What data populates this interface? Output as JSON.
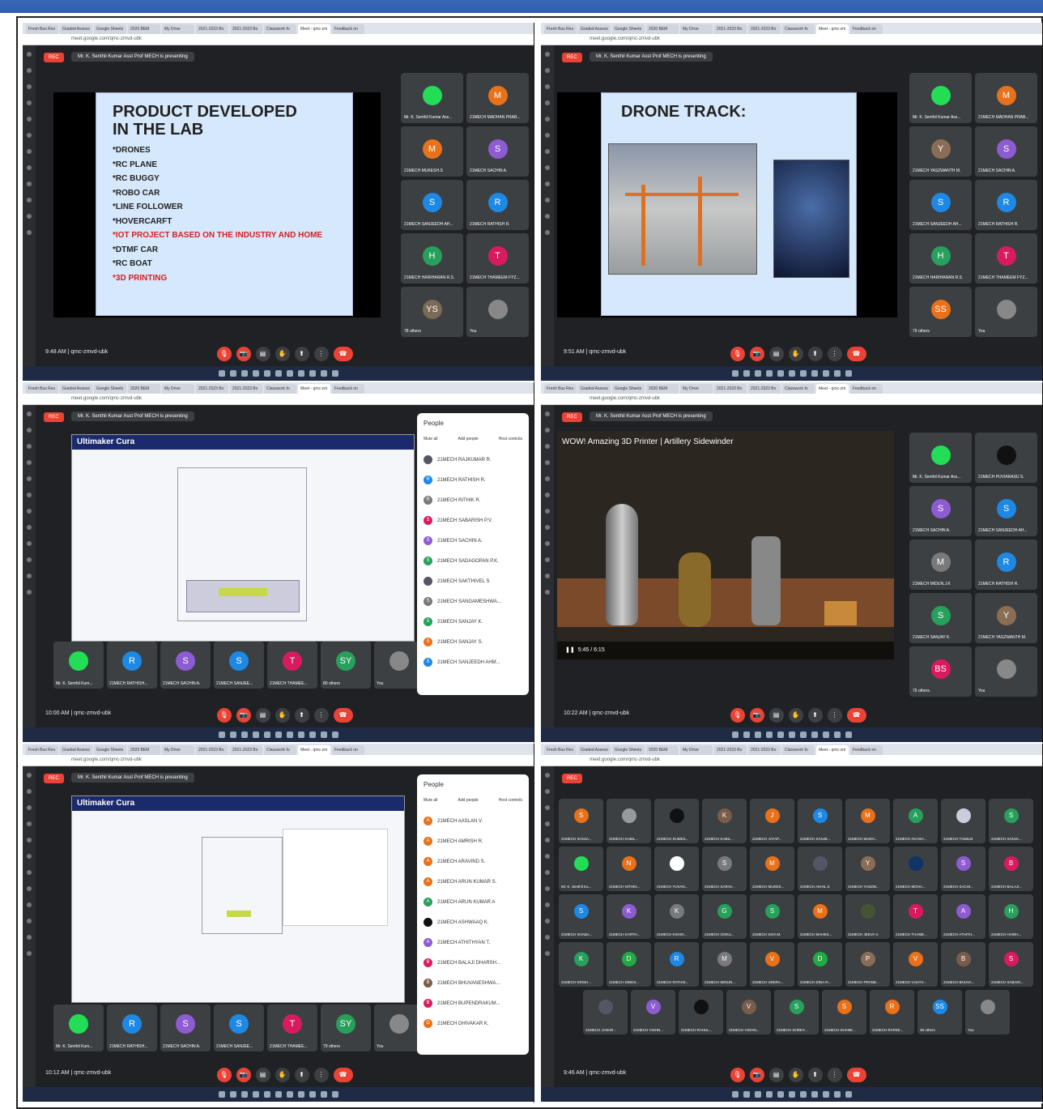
{
  "browser": {
    "tabs": [
      "Fresh Bus Res",
      "Graded Assess",
      "Google Sheets",
      "2020 BEM",
      "My Drive",
      "2021-2023 Bo",
      "2021-2023 Bo",
      "Classwork fo",
      "Meet - qmc-zm",
      "Feedback on"
    ],
    "url": "meet.google.com/qmc-zmvd-ubk"
  },
  "meet": {
    "rec": "REC",
    "presenting": "Mr. K. Senthil Kumar Asst Prof MECH is presenting",
    "code": "qmc-zmvd-ubk"
  },
  "s1": {
    "time": "9:48 AM",
    "slide_title": "PRODUCT DEVELOPED IN THE LAB",
    "items": [
      "DRONES",
      "RC PLANE",
      "RC BUGGY",
      "ROBO CAR",
      "LINE FOLLOWER",
      "HOVERCARFT",
      "IOT PROJECT BASED ON THE INDUSTRY AND HOME",
      "DTMF CAR",
      "RC BOAT",
      "3D PRINTING"
    ],
    "tiles": [
      {
        "n": "Mr. K. Senthil Kumar Ass...",
        "l": "",
        "c": "#2d5"
      },
      {
        "n": "21MECH MADHAN PRAB...",
        "l": "M",
        "c": "#e8711a"
      },
      {
        "n": "21MECH MUKESH.S",
        "l": "M",
        "c": "#e8711a"
      },
      {
        "n": "21MECH SACHIN A.",
        "l": "S",
        "c": "#8e5cd1"
      },
      {
        "n": "21MECH SANJEEDH AH...",
        "l": "S",
        "c": "#1e88e5"
      },
      {
        "n": "21MECH RATHISH R.",
        "l": "R",
        "c": "#1e88e5"
      },
      {
        "n": "21MECH HARIHARAN R.S.",
        "l": "H",
        "c": "#27a05b"
      },
      {
        "n": "21MECH THAMEEM FYZ...",
        "l": "T",
        "c": "#d81b60"
      },
      {
        "n": "78 others",
        "l": "YS",
        "c": "#7a6b55"
      },
      {
        "n": "You",
        "l": "",
        "c": "#888"
      }
    ]
  },
  "s2": {
    "time": "9:51 AM",
    "slide_title": "DRONE TRACK:",
    "tiles": [
      {
        "n": "Mr. K. Senthil Kumar Ass...",
        "l": "",
        "c": "#2d5"
      },
      {
        "n": "21MECH MADHAN PRAB...",
        "l": "M",
        "c": "#e8711a"
      },
      {
        "n": "21MECH YASZWANTH M.",
        "l": "Y",
        "c": "#8a6d55"
      },
      {
        "n": "21MECH SACHIN A.",
        "l": "S",
        "c": "#8e5cd1"
      },
      {
        "n": "21MECH SANJEEDH AH...",
        "l": "S",
        "c": "#1e88e5"
      },
      {
        "n": "21MECH RATHISH R.",
        "l": "R",
        "c": "#1e88e5"
      },
      {
        "n": "21MECH HARIHARAN R.S.",
        "l": "H",
        "c": "#27a05b"
      },
      {
        "n": "21MECH THAMEEM FYZ...",
        "l": "T",
        "c": "#d81b60"
      },
      {
        "n": "79 others",
        "l": "SS",
        "c": "#e8711a"
      },
      {
        "n": "You",
        "l": "",
        "c": "#888"
      }
    ]
  },
  "s3": {
    "time": "10:00 AM",
    "app": "Ultimaker Cura",
    "people_title": "People",
    "mute": "Mute all",
    "add": "Add people",
    "host": "Host controls",
    "people": [
      {
        "n": "21MECH RAJKUMAR R.",
        "l": "",
        "c": "#556"
      },
      {
        "n": "21MECH RATHISH R.",
        "l": "R",
        "c": "#1e88e5"
      },
      {
        "n": "21MECH RITHIK R.",
        "l": "R",
        "c": "#7a7a7a"
      },
      {
        "n": "21MECH SABARISH P.V.",
        "l": "S",
        "c": "#d81b60"
      },
      {
        "n": "21MECH SACHIN A.",
        "l": "S",
        "c": "#8e5cd1"
      },
      {
        "n": "21MECH SADAGOPAN P.K.",
        "l": "S",
        "c": "#27a05b"
      },
      {
        "n": "21MECH SAKTHIVEL S",
        "l": "",
        "c": "#556"
      },
      {
        "n": "21MECH SANGAMESHWA...",
        "l": "S",
        "c": "#7a7a7a"
      },
      {
        "n": "21MECH SANJAY K.",
        "l": "S",
        "c": "#27a05b"
      },
      {
        "n": "21MECH SANJAY S.",
        "l": "S",
        "c": "#e8711a"
      },
      {
        "n": "21MECH SANJEEDH AHM...",
        "l": "S",
        "c": "#1e88e5"
      }
    ],
    "strip": [
      {
        "n": "Mr. K. Senthil Kum...",
        "l": "",
        "c": "#2d5"
      },
      {
        "n": "21MECH RATHISH...",
        "l": "R",
        "c": "#1e88e5"
      },
      {
        "n": "21MECH SACHIN A.",
        "l": "S",
        "c": "#8e5cd1"
      },
      {
        "n": "21MECH SANJEE...",
        "l": "S",
        "c": "#1e88e5"
      },
      {
        "n": "21MECH THAMEE...",
        "l": "T",
        "c": "#d81b60"
      },
      {
        "n": "80 others",
        "l": "SY",
        "c": "#27a05b"
      },
      {
        "n": "You",
        "l": "",
        "c": "#888"
      }
    ]
  },
  "s4": {
    "time": "10:22 AM",
    "video_title": "WOW! Amazing 3D Printer | Artillery Sidewinder",
    "video_time": "5:45 / 6:15",
    "tiles": [
      {
        "n": "Mr. K. Senthil Kumar Ass...",
        "l": "",
        "c": "#2d5"
      },
      {
        "n": "21MECH PUVIARASU S.",
        "l": "",
        "c": "#111"
      },
      {
        "n": "21MECH SACHIN A.",
        "l": "S",
        "c": "#8e5cd1"
      },
      {
        "n": "21MECH SANJEEDH AH...",
        "l": "S",
        "c": "#1e88e5"
      },
      {
        "n": "21MECH MIDUN.J.K",
        "l": "M",
        "c": "#7a7a7a"
      },
      {
        "n": "21MECH RATHISH R.",
        "l": "R",
        "c": "#1e88e5"
      },
      {
        "n": "21MECH SANJAY K.",
        "l": "S",
        "c": "#27a05b"
      },
      {
        "n": "21MECH YASZWANTH M.",
        "l": "Y",
        "c": "#8a6d55"
      },
      {
        "n": "76 others",
        "l": "BS",
        "c": "#d81b60"
      },
      {
        "n": "You",
        "l": "",
        "c": "#888"
      }
    ]
  },
  "s5": {
    "time": "10:12 AM",
    "app": "Ultimaker Cura",
    "people_title": "People",
    "mute": "Mute all",
    "add": "Add people",
    "host": "Host controls",
    "people": [
      {
        "n": "21MECH AASLAN V.",
        "l": "A",
        "c": "#e8711a"
      },
      {
        "n": "21MECH AMRISH R.",
        "l": "A",
        "c": "#e8711a"
      },
      {
        "n": "21MECH ARAVIND S.",
        "l": "A",
        "c": "#e8711a"
      },
      {
        "n": "21MECH ARUN KUMAR S.",
        "l": "A",
        "c": "#e8711a"
      },
      {
        "n": "21MECH ARUN KUMAR A",
        "l": "A",
        "c": "#27a05b"
      },
      {
        "n": "21MECH ASHWAAQ K.",
        "l": "",
        "c": "#111"
      },
      {
        "n": "21MECH ATHITHYAN T.",
        "l": "A",
        "c": "#8e5cd1"
      },
      {
        "n": "21MECH BALAJI DHARSH...",
        "l": "B",
        "c": "#d81b60"
      },
      {
        "n": "21MECH BHUVANESHWA...",
        "l": "B",
        "c": "#7a5c4a"
      },
      {
        "n": "21MECH BUPENDRAKUM...",
        "l": "B",
        "c": "#d81b60"
      },
      {
        "n": "21MECH DHIVAKAR K.",
        "l": "D",
        "c": "#e8711a"
      }
    ],
    "strip": [
      {
        "n": "Mr. K. Senthil Kum...",
        "l": "",
        "c": "#2d5"
      },
      {
        "n": "21MECH RATHISH...",
        "l": "R",
        "c": "#1e88e5"
      },
      {
        "n": "21MECH SACHIN A.",
        "l": "S",
        "c": "#8e5cd1"
      },
      {
        "n": "21MECH SANJEE...",
        "l": "S",
        "c": "#1e88e5"
      },
      {
        "n": "21MECH THAMEE...",
        "l": "T",
        "c": "#d81b60"
      },
      {
        "n": "79 others",
        "l": "SY",
        "c": "#27a05b"
      },
      {
        "n": "You",
        "l": "",
        "c": "#888"
      }
    ]
  },
  "s6": {
    "time": "9:46 AM",
    "grid": [
      {
        "n": "21MECH SANJA...",
        "l": "S",
        "c": "#e8711a"
      },
      {
        "n": "21MECH KABIL...",
        "l": "",
        "c": "#999"
      },
      {
        "n": "21MECH SUMES...",
        "l": "",
        "c": "#111"
      },
      {
        "n": "21MECH KABIL...",
        "l": "K",
        "c": "#7a5c4a"
      },
      {
        "n": "21MECH JAYAP...",
        "l": "J",
        "c": "#e8711a"
      },
      {
        "n": "21MECH SANJE...",
        "l": "S",
        "c": "#1e88e5"
      },
      {
        "n": "21MECH MADH...",
        "l": "M",
        "c": "#e8711a"
      },
      {
        "n": "21MECH AKASH...",
        "l": "A",
        "c": "#27a05b"
      },
      {
        "n": "21MECH TAMILM",
        "l": "",
        "c": "#ccd"
      },
      {
        "n": "21MECH SANJA...",
        "l": "S",
        "c": "#27a05b"
      },
      {
        "n": "Mr. K. Senthil Ku...",
        "l": "",
        "c": "#2d5"
      },
      {
        "n": "21MECH NITHIN...",
        "l": "N",
        "c": "#e8711a"
      },
      {
        "n": "21MECH YUVAN...",
        "l": "",
        "c": "#fff"
      },
      {
        "n": "21MECH SARAV...",
        "l": "S",
        "c": "#7a7a7a"
      },
      {
        "n": "21MECH MUKES...",
        "l": "M",
        "c": "#e8711a"
      },
      {
        "n": "21MECH AKHIL.S",
        "l": "",
        "c": "#556"
      },
      {
        "n": "21MECH YASZW...",
        "l": "Y",
        "c": "#8a6d55"
      },
      {
        "n": "21MECH MOHA...",
        "l": "",
        "c": "#136"
      },
      {
        "n": "21MECH SACHI...",
        "l": "S",
        "c": "#8e5cd1"
      },
      {
        "n": "21MECH BALAJI...",
        "l": "B",
        "c": "#d81b60"
      },
      {
        "n": "21MECH SHABA...",
        "l": "S",
        "c": "#1e88e5"
      },
      {
        "n": "21MECH KARTH...",
        "l": "K",
        "c": "#8e5cd1"
      },
      {
        "n": "21MECH KISHO...",
        "l": "K",
        "c": "#7a7a7a"
      },
      {
        "n": "21MECH GOKU...",
        "l": "G",
        "c": "#27a05b"
      },
      {
        "n": "21MECH SIVA M.",
        "l": "S",
        "c": "#27a05b"
      },
      {
        "n": "21MECH MAHES...",
        "l": "M",
        "c": "#e8711a"
      },
      {
        "n": "21MECH JEEVA V.",
        "l": "",
        "c": "#453"
      },
      {
        "n": "21MECH THAME...",
        "l": "T",
        "c": "#d81b60"
      },
      {
        "n": "21MECH ATHITH...",
        "l": "A",
        "c": "#8e5cd1"
      },
      {
        "n": "21MECH HARIH...",
        "l": "H",
        "c": "#27a05b"
      },
      {
        "n": "21MECH KRISH...",
        "l": "K",
        "c": "#27a05b"
      },
      {
        "n": "21MECH DINES...",
        "l": "D",
        "c": "#2a4"
      },
      {
        "n": "21MECH RATHIS...",
        "l": "R",
        "c": "#1e88e5"
      },
      {
        "n": "21MECH MIDUN...",
        "l": "M",
        "c": "#7a7a7a"
      },
      {
        "n": "21MECH VEERA...",
        "l": "V",
        "c": "#e8711a"
      },
      {
        "n": "21MECH DINA R...",
        "l": "D",
        "c": "#2a4"
      },
      {
        "n": "21MECH PRANE...",
        "l": "P",
        "c": "#8a6d55"
      },
      {
        "n": "21MECH VIJAYV...",
        "l": "V",
        "c": "#e8711a"
      },
      {
        "n": "21MECH BHUVA...",
        "l": "B",
        "c": "#7a5c4a"
      },
      {
        "n": "21MECH SABARI...",
        "l": "S",
        "c": "#d81b60"
      },
      {
        "n": "21MECH JANAR...",
        "l": "",
        "c": "#556"
      },
      {
        "n": "21MECH VISHN...",
        "l": "V",
        "c": "#8e5cd1"
      },
      {
        "n": "21MECH RAHUL...",
        "l": "",
        "c": "#111"
      },
      {
        "n": "21MECH VIGHN...",
        "l": "V",
        "c": "#7a5c4a"
      },
      {
        "n": "21MECH SHREY...",
        "l": "S",
        "c": "#27a05b"
      },
      {
        "n": "21MECH SHANK...",
        "l": "S",
        "c": "#e8711a"
      },
      {
        "n": "21MECH RAFEE...",
        "l": "R",
        "c": "#e8711a"
      },
      {
        "n": "39 others",
        "l": "SS",
        "c": "#1e88e5"
      },
      {
        "n": "You",
        "l": "",
        "c": "#888"
      }
    ]
  }
}
